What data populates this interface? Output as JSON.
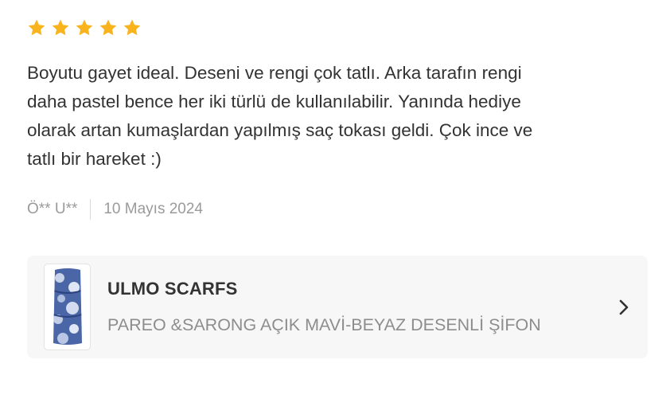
{
  "review": {
    "rating": 5,
    "star_color": "#F9B31C",
    "text": "Boyutu gayet ideal. Deseni ve rengi çok tatlı. Arka tarafın rengi\ndaha pastel bence her iki türlü de kullanılabilir. Yanında hediye\nolarak artan kumaşlardan yapılmış saç tokası geldi. Çok ince ve\ntatlı bir hareket :)",
    "author": "Ö** U**",
    "date": "10 Mayıs 2024"
  },
  "product": {
    "brand": "ULMO SCARFS",
    "name": "PAREO &SARONG AÇIK MAVİ-BEYAZ DESENLİ ŞİFON",
    "thumbnail_icon": "scarf-thumbnail",
    "action_icon": "chevron-right-icon"
  }
}
